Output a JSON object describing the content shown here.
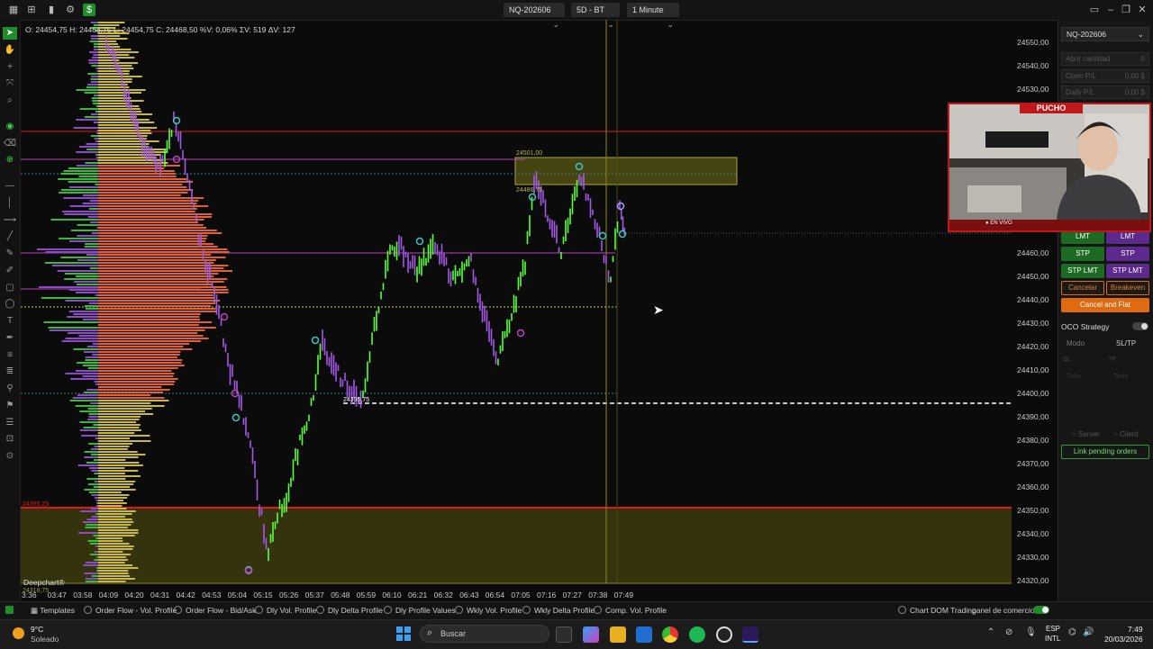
{
  "topbar": {
    "instrument": "NQ-202606",
    "period": "5D - BT",
    "timeframe": "1 Minute"
  },
  "ohlc_readout": "O: 24454,75  H: 24468,75  L: 24454,75  C: 24468,50  %V: 0,06%  ΣV: 519  ΔV: 127",
  "chart": {
    "price_labels": [
      "24550,00",
      "24540,00",
      "24530,00",
      "24460,00",
      "24450,00",
      "24440,00",
      "24430,00",
      "24420,00",
      "24410,00",
      "24400,00",
      "24390,00",
      "24380,00",
      "24370,00",
      "24360,00",
      "24350,00",
      "24340,00",
      "24330,00",
      "24320,00"
    ],
    "time_labels": [
      "3:36",
      "03:47",
      "03:58",
      "04:09",
      "04:20",
      "04:31",
      "04:42",
      "04:53",
      "05:04",
      "05:15",
      "05:26",
      "05:37",
      "05:48",
      "05:59",
      "06:10",
      "06:21",
      "06:32",
      "06:43",
      "06:54",
      "07:05",
      "07:16",
      "07:27",
      "07:38",
      "07:49"
    ],
    "zone_top_label": "24501,00",
    "zone_bottom_label": "24486,75",
    "level_label": "24395,75",
    "poc_label": "24355,25",
    "bottom_zone_label": "24318,75",
    "brand": "Deepchart®"
  },
  "right_panel": {
    "instrument": "NQ-202606",
    "qty_label": "Abrir cantidad",
    "qty_value": "0",
    "open_pl_label": "Open P/L",
    "open_pl_value": "0,00 $",
    "daily_pl_label": "Daily P/L",
    "daily_pl_value": "0,00 $",
    "buy_lmt": "LMT",
    "sell_lmt": "LMT",
    "buy_stp": "STP",
    "sell_stp": "STP",
    "buy_stplmt": "STP LMT",
    "sell_stplmt": "STP LMT",
    "cancel": "Cancelar",
    "breakeven": "Breakeven",
    "cancel_flat": "Cancel and Flat",
    "oco_label": "OCO Strategy",
    "modo_label": "Modo",
    "modo_value": "SL/TP",
    "sl_label": "SL",
    "tp_label": "TP",
    "ticks1": "Ticks",
    "ticks2": "Ticks",
    "server_label": "Server",
    "client_label": "Client",
    "link_pending": "Link pending orders"
  },
  "webcam": {
    "banner": "PUCHO",
    "live": "● EN VIVO"
  },
  "bottom_tabs": {
    "templates": "Templates",
    "tab1": "Order Flow - Vol. Profile",
    "tab2": "Order Flow - Bid/Ask",
    "tab3": "Dly Vol. Profile",
    "tab4": "Dly Delta Profile",
    "tab5": "Dly Profile Values",
    "tab6": "Wkly Vol. Profile",
    "tab7": "Wkly Delta Profile",
    "tab8": "Comp. Vol. Profile",
    "tab9": "Chart DOM Trading",
    "tab10": "panel de comercio"
  },
  "taskbar": {
    "temp": "9°C",
    "weather": "Soleado",
    "search_placeholder": "Buscar",
    "lang1": "ESP",
    "lang2": "INTL",
    "time": "7:49",
    "date": "20/03/2026"
  },
  "colors": {
    "bull": "#5cff3a",
    "bear": "#a259e6",
    "zone": "#6b6a14",
    "level_red": "#e01818",
    "accent_orange": "#e06a10"
  }
}
